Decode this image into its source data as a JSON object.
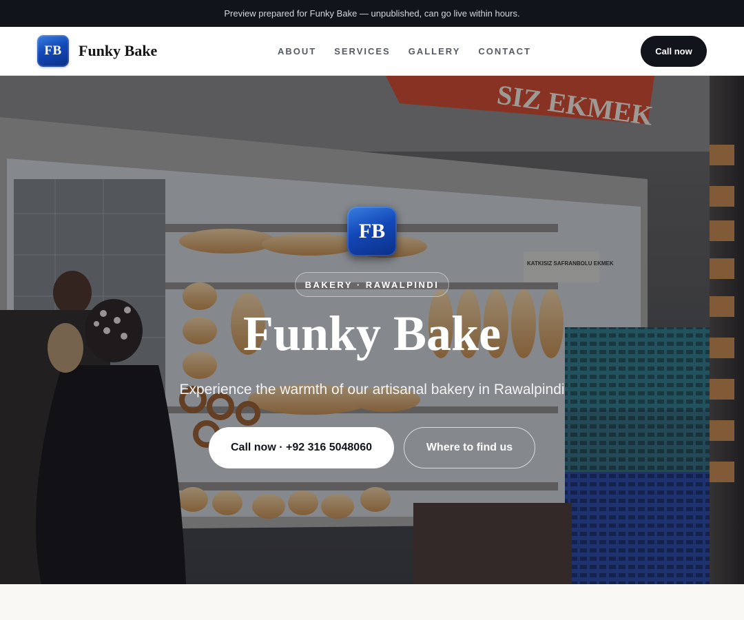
{
  "topbar": {
    "text": "Preview prepared for Funky Bake — unpublished, can go live within hours."
  },
  "nav": {
    "logo_initials": "FB",
    "brand_name": "Funky Bake",
    "menu": [
      "ABOUT",
      "SERVICES",
      "GALLERY",
      "CONTACT"
    ],
    "call_label": "Call now"
  },
  "hero": {
    "logo_initials": "FB",
    "badge": "BAKERY · RAWALPINDI",
    "title": "Funky Bake",
    "subtitle": "Experience the warmth of our artisanal bakery in Rawalpindi",
    "primary_button": "Call now · +92 316 5048060",
    "secondary_button": "Where to find us",
    "sign_text": "SIZ EKMEK",
    "shelf_sign_text": "KATKISIZ SAFRANBOLU EKMEK"
  },
  "colors": {
    "dark": "#11141b",
    "brand_blue": "#1348b8",
    "sign_red": "#d2492a"
  }
}
